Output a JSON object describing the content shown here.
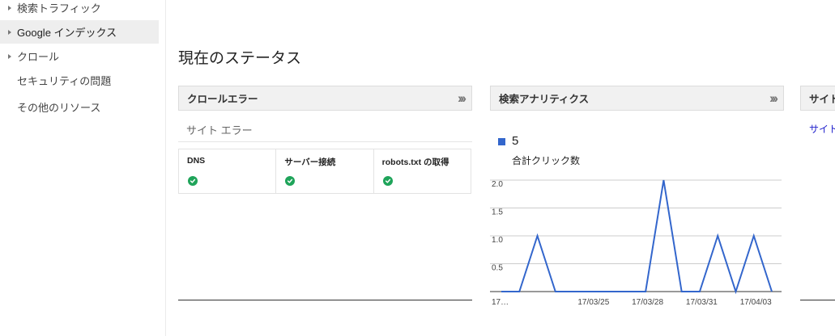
{
  "sidebar": {
    "items": [
      {
        "label": "検索トラフィック",
        "arrow": true,
        "active": false
      },
      {
        "label": "Google インデックス",
        "arrow": true,
        "active": true
      },
      {
        "label": "クロール",
        "arrow": true,
        "active": false
      },
      {
        "label": "セキュリティの問題",
        "arrow": false,
        "active": false
      },
      {
        "label": "その他のリソース",
        "arrow": false,
        "active": false
      }
    ]
  },
  "main": {
    "title": "現在のステータス"
  },
  "crawl_errors": {
    "title": "クロールエラー",
    "subtitle": "サイト エラー",
    "cells": [
      {
        "label": "DNS",
        "status": "ok"
      },
      {
        "label": "サーバー接続",
        "status": "ok"
      },
      {
        "label": "robots.txt の取得",
        "status": "ok"
      }
    ]
  },
  "analytics": {
    "title": "検索アナリティクス",
    "total_value": "5",
    "total_label": "合計クリック数"
  },
  "third_card": {
    "title": "サイトマップ",
    "link": "サイトマップ"
  },
  "colors": {
    "line": "#3366cc",
    "ok": "#1fa45a"
  },
  "chart_data": {
    "type": "line",
    "x": [
      "17/03/20",
      "17/03/21",
      "17/03/22",
      "17/03/23",
      "17/03/24",
      "17/03/25",
      "17/03/26",
      "17/03/27",
      "17/03/28",
      "17/03/29",
      "17/03/30",
      "17/03/31",
      "17/04/01",
      "17/04/02",
      "17/04/03",
      "17/04/04"
    ],
    "series": [
      {
        "values": [
          0,
          0,
          1,
          0,
          0,
          0,
          0,
          0,
          0,
          2,
          0,
          0,
          1,
          0,
          1,
          0
        ]
      }
    ],
    "y_ticks": [
      "0.5",
      "1.0",
      "1.5",
      "2.0"
    ],
    "x_ticks": [
      "17…",
      "17/03/25",
      "17/03/28",
      "17/03/31",
      "17/04/03"
    ],
    "ylim": [
      0,
      2.2
    ],
    "grid": true
  }
}
